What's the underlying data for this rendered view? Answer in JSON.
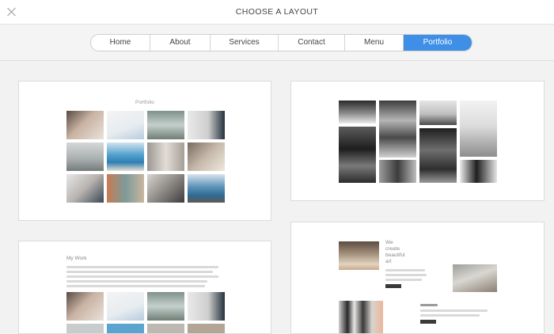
{
  "header": {
    "title": "CHOOSE A LAYOUT",
    "close_icon": "close-icon"
  },
  "tabs": [
    {
      "label": "Home",
      "active": false
    },
    {
      "label": "About",
      "active": false
    },
    {
      "label": "Services",
      "active": false
    },
    {
      "label": "Contact",
      "active": false
    },
    {
      "label": "Menu",
      "active": false
    },
    {
      "label": "Portfolio",
      "active": true
    }
  ],
  "layouts": {
    "grid_portfolio": {
      "heading": "Portfolio"
    },
    "mosaic_bw": {},
    "my_work": {
      "heading": "My Work"
    },
    "feature": {
      "heading_lines": [
        "We",
        "create",
        "beautiful",
        "art"
      ]
    }
  },
  "colors": {
    "accent": "#3f8fe6",
    "background": "#f2f2f2",
    "card": "#ffffff"
  }
}
